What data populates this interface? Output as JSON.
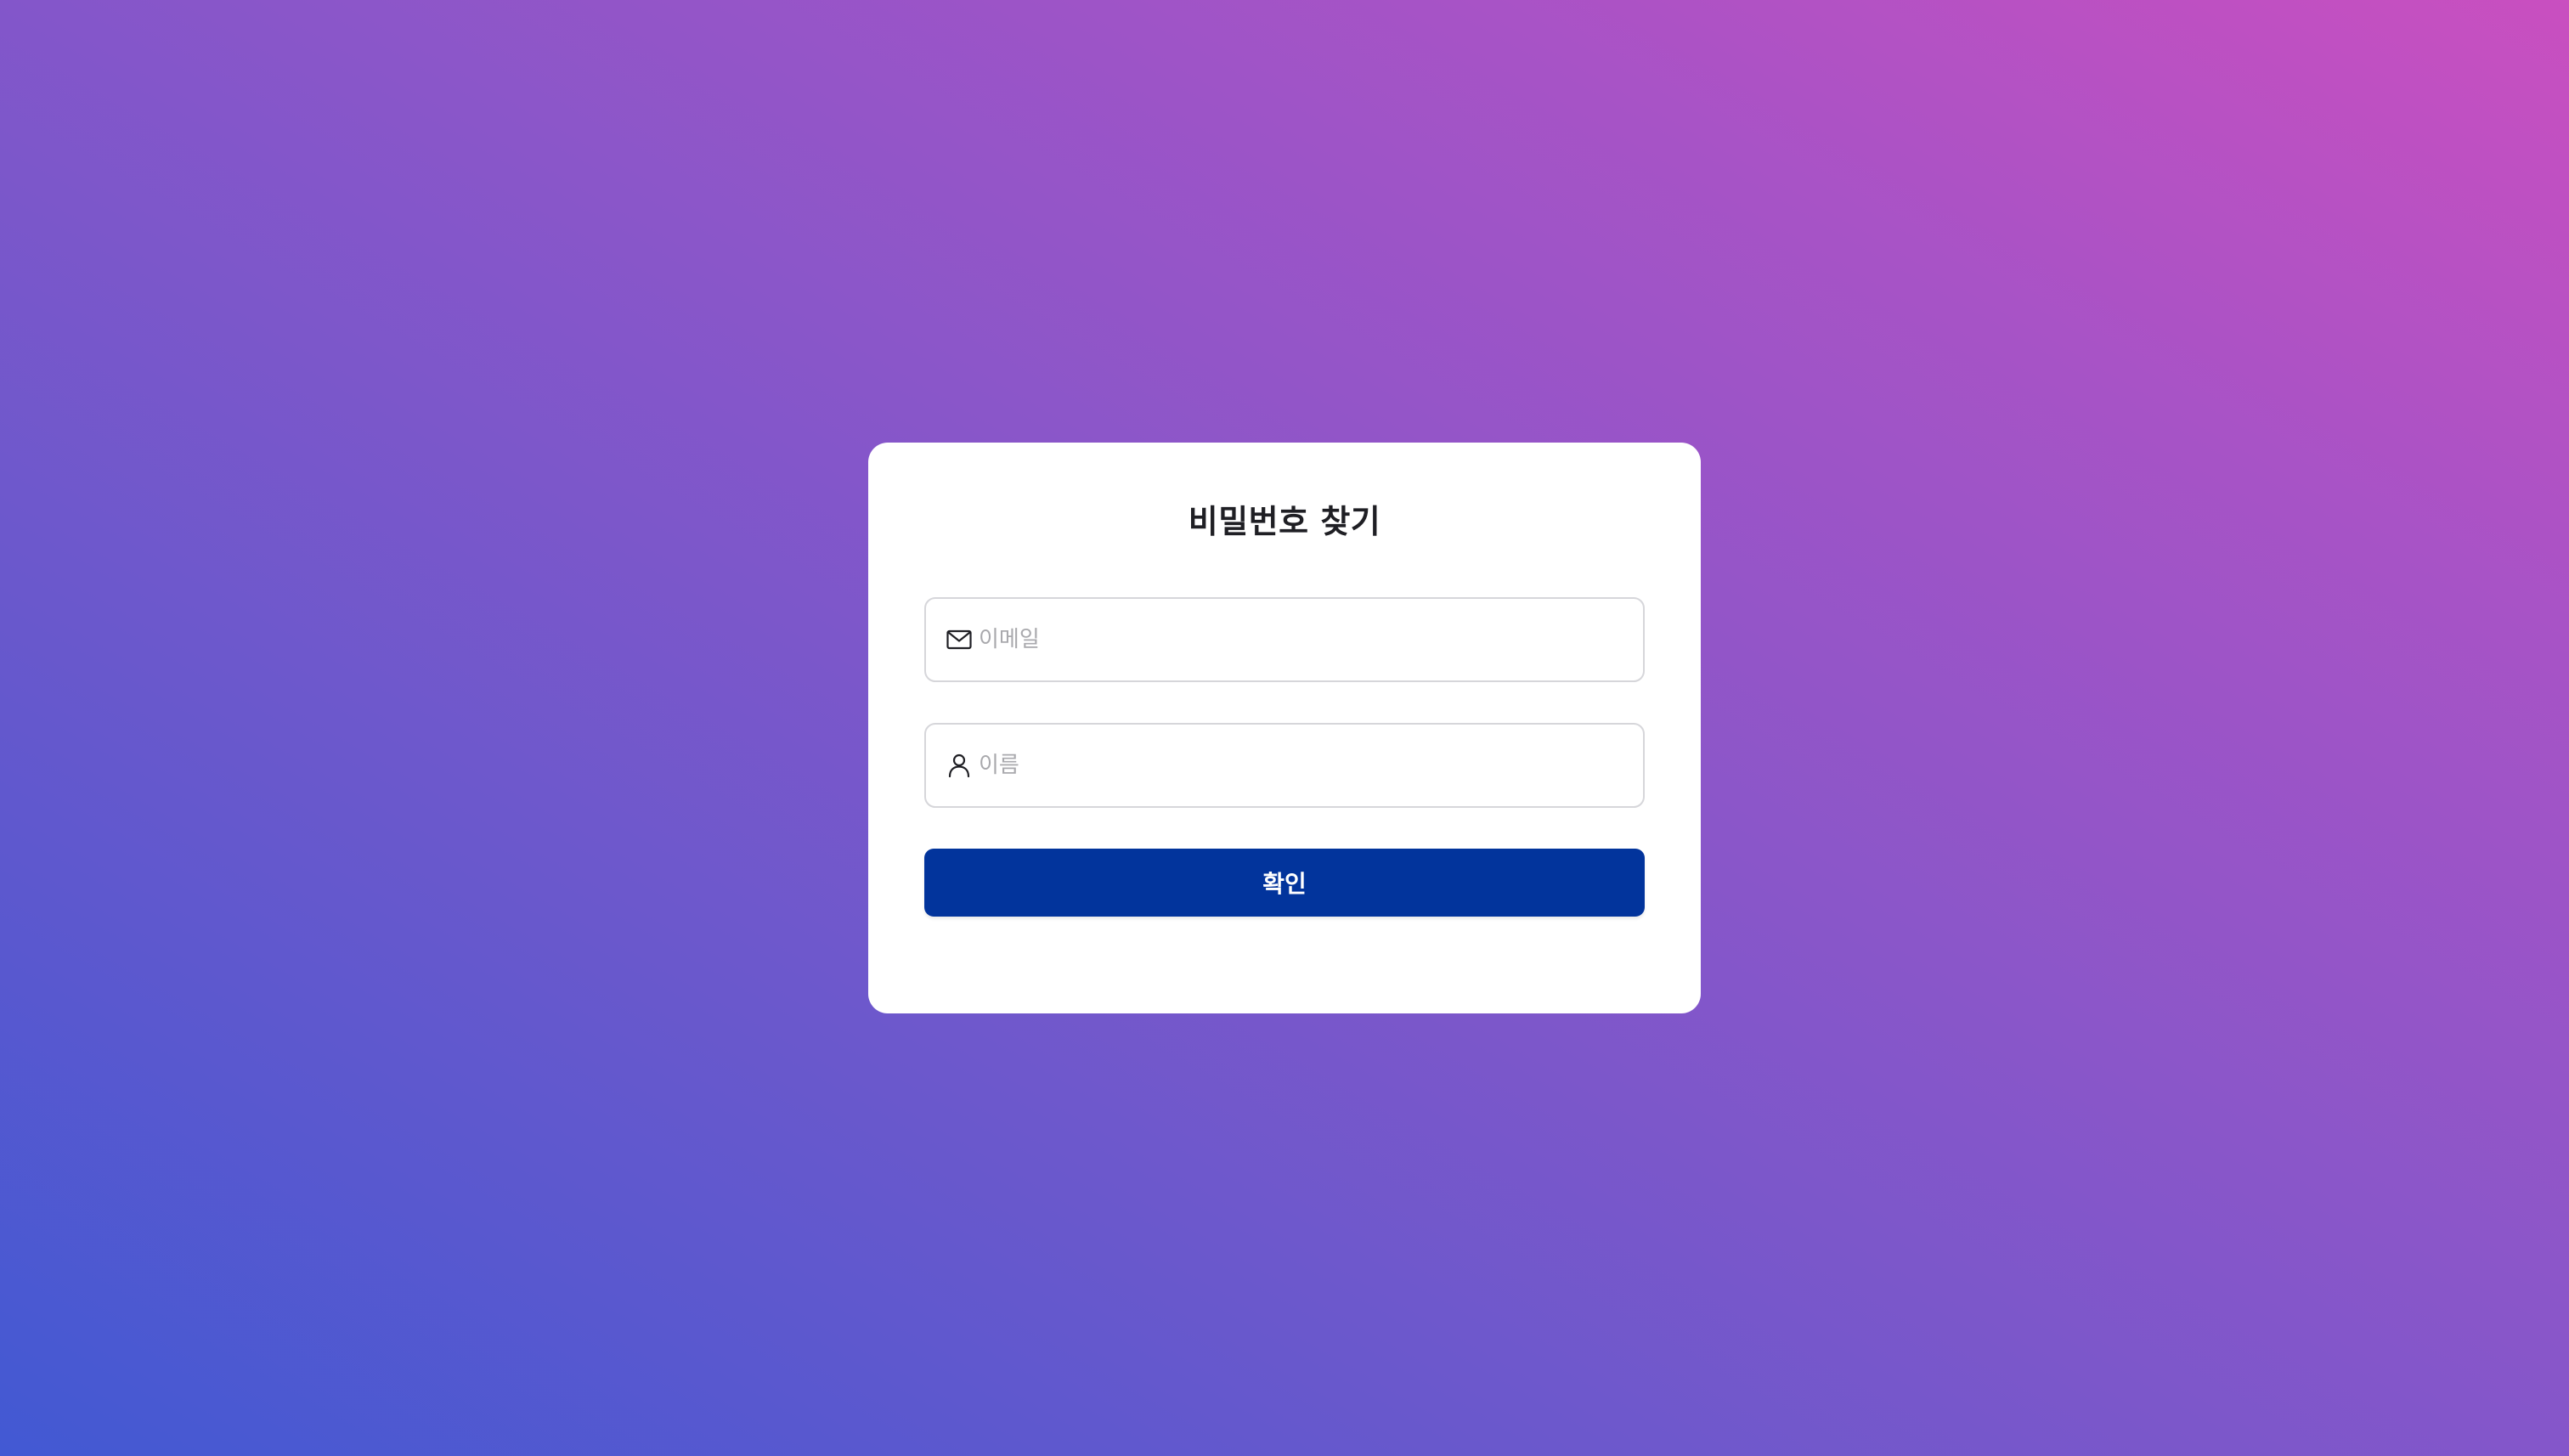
{
  "page": {
    "title": "비밀번호 찾기"
  },
  "form": {
    "email": {
      "icon": "mail-icon",
      "placeholder": "이메일",
      "value": ""
    },
    "name": {
      "icon": "user-icon",
      "placeholder": "이름",
      "value": ""
    },
    "submit_label": "확인"
  },
  "colors": {
    "background_gradient": [
      "#4259d3",
      "#c94fc0"
    ],
    "card": "#ffffff",
    "button": "#02349c",
    "button_text": "#ffffff",
    "title_text": "#1f1f24",
    "placeholder_text": "#a9a9ad",
    "field_border": "#d6d6da"
  }
}
